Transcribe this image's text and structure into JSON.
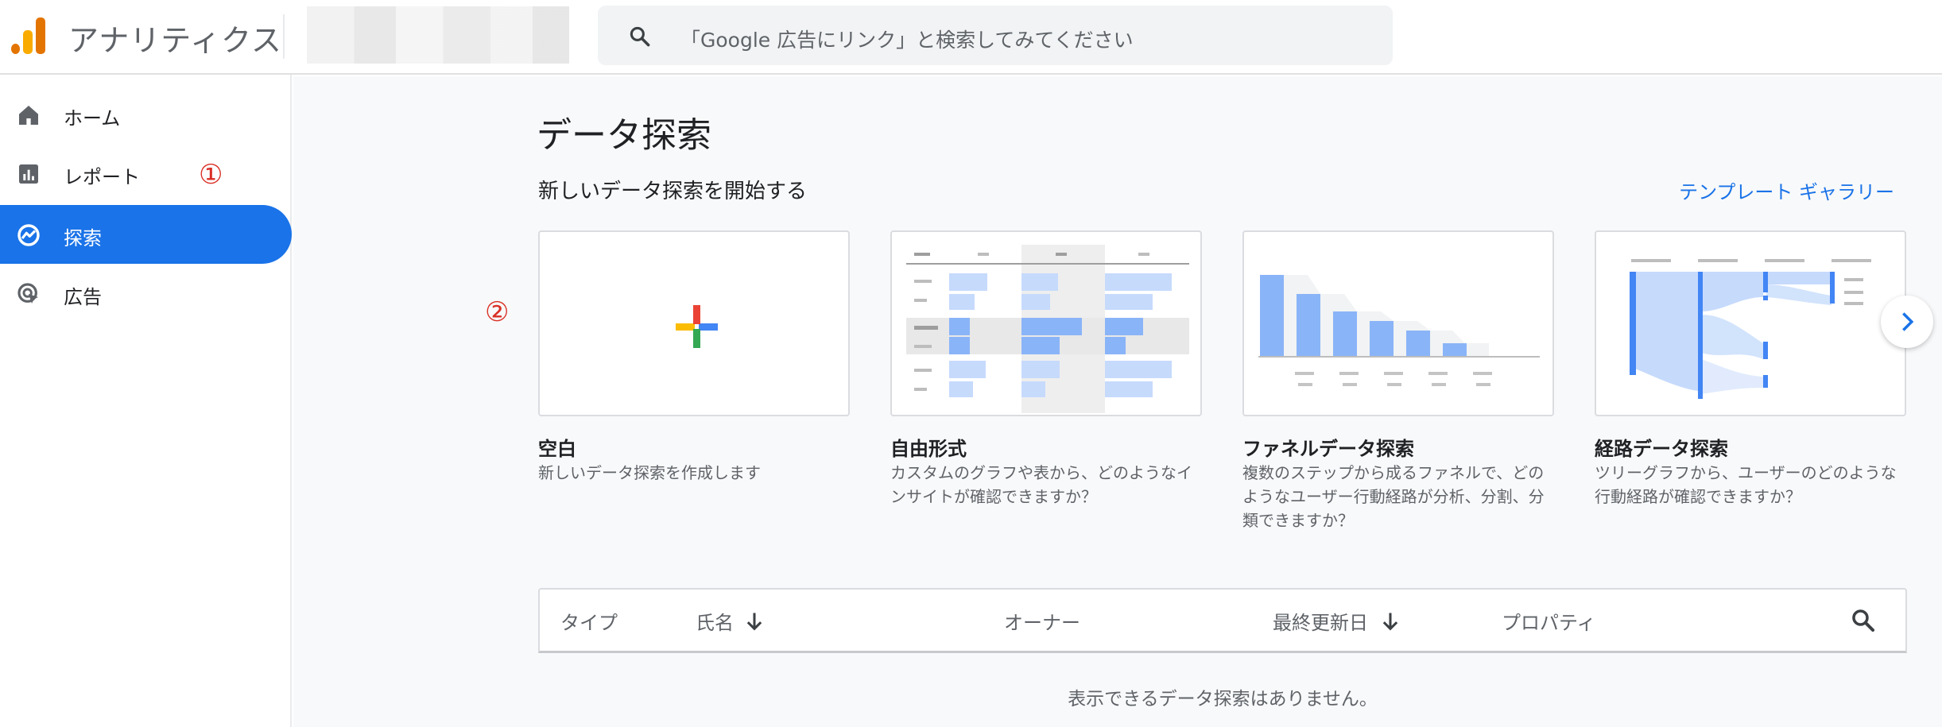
{
  "header": {
    "app_title": "アナリティクス",
    "search_placeholder": "「Google 広告にリンク」と検索してみてください"
  },
  "sidebar": {
    "items": [
      {
        "label": "ホーム",
        "icon": "home-icon"
      },
      {
        "label": "レポート",
        "icon": "bar-chart-icon"
      },
      {
        "label": "探索",
        "icon": "explore-icon",
        "active": true
      },
      {
        "label": "広告",
        "icon": "advertising-icon"
      }
    ]
  },
  "annotations": {
    "one": "①",
    "two": "②"
  },
  "main": {
    "title": "データ探索",
    "section_title": "新しいデータ探索を開始する",
    "gallery_link": "テンプレート ギャラリー",
    "cards": [
      {
        "title": "空白",
        "desc": "新しいデータ探索を作成します"
      },
      {
        "title": "自由形式",
        "desc": "カスタムのグラフや表から、どのようなインサイトが確認できますか？"
      },
      {
        "title": "ファネルデータ探索",
        "desc": "複数のステップから成るファネルで、どのようなユーザー行動経路が分析、分割、分類できますか？"
      },
      {
        "title": "経路データ探索",
        "desc": "ツリーグラフから、ユーザーのどのような行動経路が確認できますか？"
      }
    ],
    "table": {
      "headers": [
        "タイプ",
        "氏名",
        "オーナー",
        "最終更新日",
        "プロパティ"
      ],
      "empty_message": "表示できるデータ探索はありません。"
    }
  },
  "colors": {
    "accent": "#1a73e8",
    "logo_orange": "#e37400",
    "logo_yellow": "#f9ab00",
    "annotation_red": "#d93025"
  }
}
